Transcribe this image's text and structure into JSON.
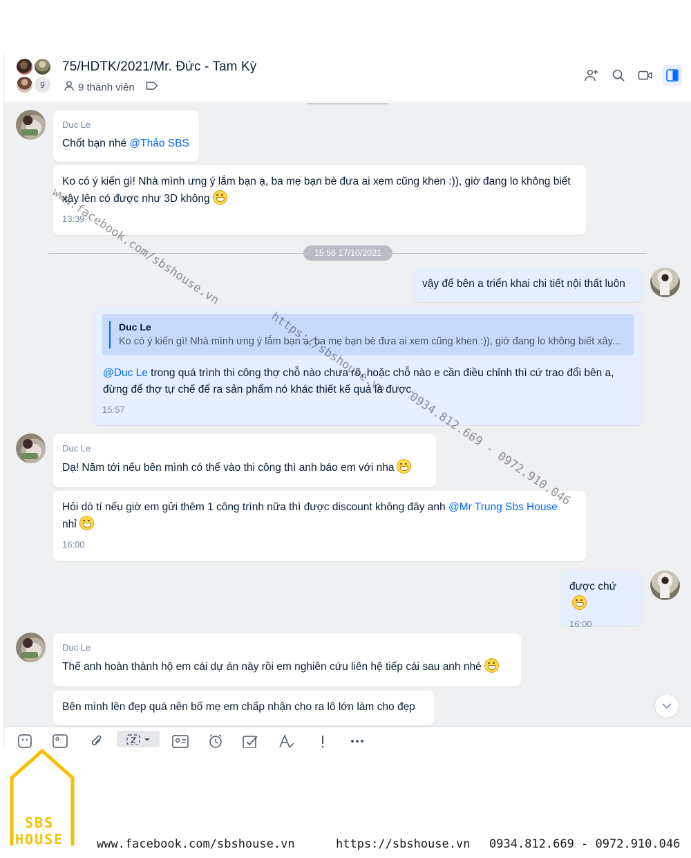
{
  "header": {
    "title": "75/HDTK/2021/Mr. Đức - Tam Kỳ",
    "members": "9 thành viên",
    "avatar_count": "9"
  },
  "messages": {
    "m1_sender": "Duc Le",
    "m1_text": "Chốt bạn nhé ",
    "m1_mention": "@Thảo SBS",
    "m2_text": "Ko có ý kiến gì! Nhà mình ưng ý lắm bạn ạ, ba mẹ bạn bè đưa ai xem cũng khen :)), giờ đang lo không biết xây lên có được như 3D không",
    "m2_time": "13:39",
    "date_divider": "15:56 17/10/2021",
    "m3_text": "vậy để bên a triển khai chi tiết nội thất luôn",
    "m4_quote_name": "Duc Le",
    "m4_quote_text": "Ko có ý kiến gì! Nhà mình ưng ý lắm bạn ạ, ba mẹ bạn bè đưa ai xem cũng khen :)), giờ đang lo không biết xây...",
    "m4_mention": "@Duc Le",
    "m4_text": " trong quá trình thi công thợ chỗ nào chưa rõ, hoặc chỗ nào e cần điều chỉnh thì cứ trao đổi bên a, đừng để thợ tự chế để ra sản phẩm nó khác thiết kế quá là được.",
    "m4_time": "15:57",
    "m5_sender": "Duc Le",
    "m5_text": "Dạ! Năm tới nếu bên mình có thể vào thi công thì anh báo em với nha",
    "m6_text": "Hỏi dò tí nếu giờ em gửi thêm 1 công trình nữa thì được discount không đây anh ",
    "m6_mention": "@Mr Trung Sbs House",
    "m6_text2": " nhỉ",
    "m6_time": "16:00",
    "m7_text": "được chứ",
    "m7_time": "16:00",
    "m8_sender": "Duc Le",
    "m8_text": "Thế anh hoàn thành hộ em cái dự án này rồi em nghiên cứu liên hệ tiếp cái sau anh nhé",
    "m9_text": "Bên mình lên đẹp quá nên bố mẹ em chấp nhận cho ra lô lớn làm cho đẹp"
  },
  "watermarks": {
    "facebook": "www.facebook.com/sbshouse.vn",
    "website": "https://sbshouse.vn",
    "phones": "0934.812.669 - 0972.910.046"
  },
  "branding": {
    "logo_line1": "SBS",
    "logo_line2": "HOUSE",
    "footer_facebook": "www.facebook.com/sbshouse.vn",
    "footer_website": "https://sbshouse.vn",
    "footer_phones": "0934.812.669 - 0972.910.046",
    "brand_color": "#f2c200"
  },
  "colors": {
    "mine_bubble": "#e5efff",
    "mention": "#0068ff",
    "background": "#eef0f1"
  },
  "icons": {
    "add_member": "add-member-icon",
    "search": "search-icon",
    "video": "video-call-icon",
    "sidebar": "sidebar-toggle-icon",
    "scroll_down": "chevron-down-icon"
  }
}
